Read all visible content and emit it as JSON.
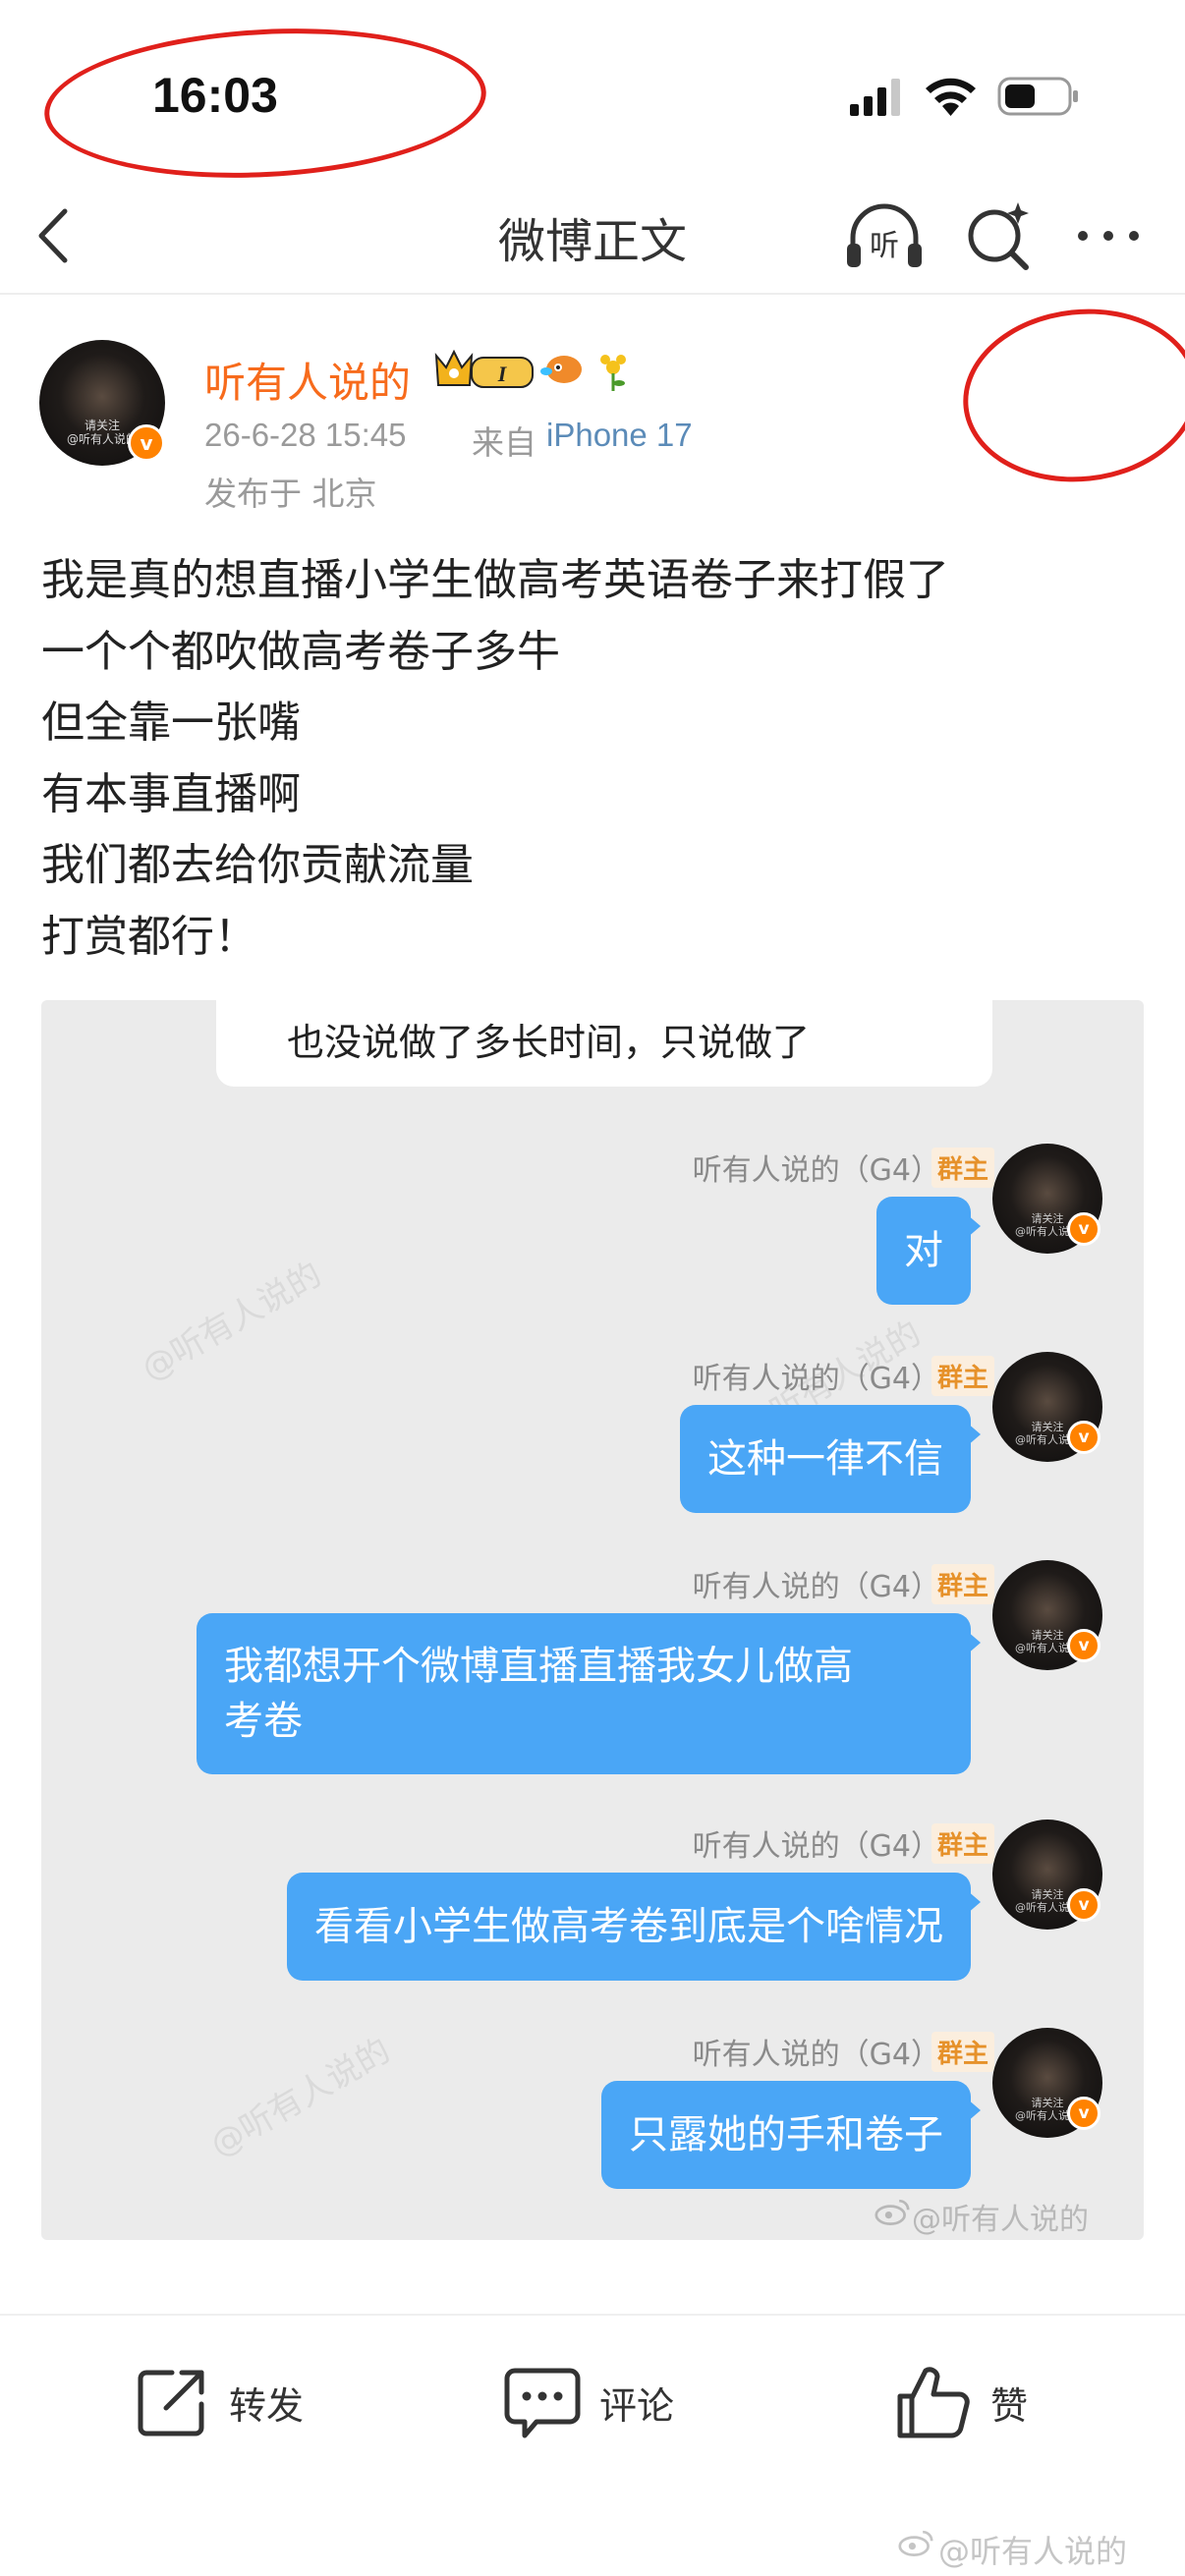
{
  "status_bar": {
    "time": "16:03",
    "icons": [
      "signal-icon",
      "wifi-icon",
      "battery-icon"
    ],
    "annotation_color": "#e0201b"
  },
  "nav": {
    "title": "微博正文",
    "icons": [
      "back-icon",
      "listen-icon",
      "ai-search-icon",
      "more-icon"
    ],
    "listen_glyph": "听"
  },
  "author": {
    "name": "听有人说的",
    "verified_badge": "v",
    "avatar_text": "请关注\n@听有人说的",
    "time": "26-6-28 15:45",
    "source_prefix": "来自",
    "device": "iPhone 17",
    "location": "发布于 北京",
    "name_color": "#f76b1c",
    "badge_level": "I"
  },
  "post": {
    "lines": [
      "我是真的想直播小学生做高考英语卷子来打假了",
      "一个个都吹做高考卷子多牛",
      "但全靠一张嘴",
      "有本事直播啊",
      "我们都去给你贡献流量",
      "打赏都行！"
    ]
  },
  "chat_image": {
    "top_message": "也没说做了多长时间，只说做了",
    "sender": "听有人说的（G4）",
    "sender_tag": "群主",
    "bubble_color": "#4aa6f6",
    "watermark": "@听有人说的",
    "credit": "@听有人说的",
    "messages": [
      {
        "text": "对"
      },
      {
        "text": "这种一律不信"
      },
      {
        "line1": "我都想开个微博直播直播我女儿做高",
        "line2": "考卷"
      },
      {
        "text": "看看小学生做高考卷到底是个啥情况"
      },
      {
        "text": "只露她的手和卷子"
      }
    ]
  },
  "toolbar": {
    "repost": "转发",
    "comment": "评论",
    "like": "赞"
  },
  "footer_watermark": "@听有人说的"
}
